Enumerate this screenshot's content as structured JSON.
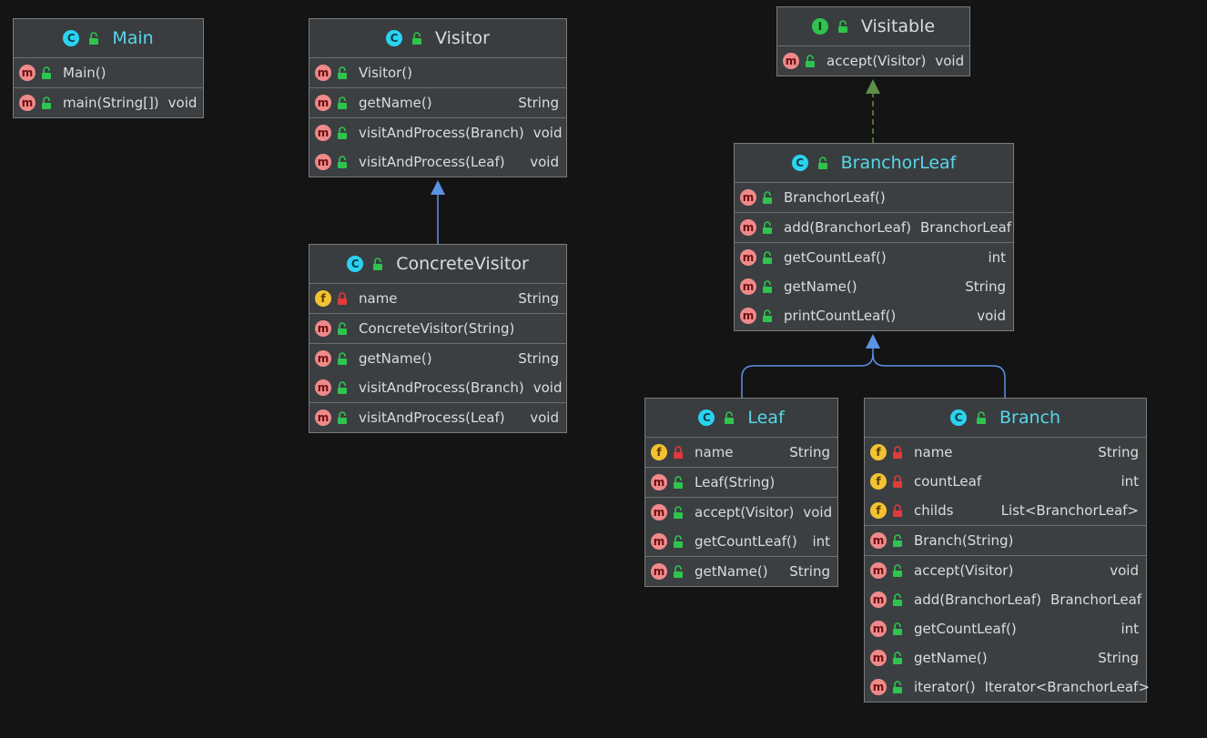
{
  "colors": {
    "background": "#141414",
    "class_box": "#3b3f42",
    "class_name_highlight": "#56d7ea",
    "method_badge": "#f08a8a",
    "field_badge": "#f2c233",
    "class_badge": "#2ad3f0",
    "interface_badge": "#2ec44e",
    "extends_arrow": "#5b93e6",
    "implements_arrow": "#5e8e4a",
    "public_lock": "#2ec44e",
    "private_lock": "#e03a3a"
  },
  "classes": {
    "main": {
      "name": "Main",
      "badge": "C",
      "rows": [
        {
          "badge": "m",
          "name": "Main()",
          "type": ""
        },
        {
          "badge": "m",
          "name": "main(String[])",
          "type": "void"
        }
      ]
    },
    "visitor": {
      "name": "Visitor",
      "badge": "C",
      "rows": [
        {
          "badge": "m",
          "name": "Visitor()",
          "type": ""
        },
        {
          "badge": "m",
          "name": "getName()",
          "type": "String"
        },
        {
          "badge": "m",
          "name": "visitAndProcess(Branch)",
          "type": "void"
        },
        {
          "badge": "m",
          "name": "visitAndProcess(Leaf)",
          "type": "void"
        }
      ]
    },
    "concrete_visitor": {
      "name": "ConcreteVisitor",
      "badge": "C",
      "rows": [
        {
          "badge": "f",
          "name": "name",
          "type": "String"
        },
        {
          "badge": "m",
          "name": "ConcreteVisitor(String)",
          "type": ""
        },
        {
          "badge": "m",
          "name": "getName()",
          "type": "String"
        },
        {
          "badge": "m",
          "name": "visitAndProcess(Branch)",
          "type": "void"
        },
        {
          "badge": "m",
          "name": "visitAndProcess(Leaf)",
          "type": "void"
        }
      ]
    },
    "visitable": {
      "name": "Visitable",
      "badge": "I",
      "rows": [
        {
          "badge": "m",
          "name": "accept(Visitor)",
          "type": "void"
        }
      ]
    },
    "branchor_leaf": {
      "name": "BranchorLeaf",
      "badge": "C",
      "rows": [
        {
          "badge": "m",
          "name": "BranchorLeaf()",
          "type": ""
        },
        {
          "badge": "m",
          "name": "add(BranchorLeaf)",
          "type": "BranchorLeaf"
        },
        {
          "badge": "m",
          "name": "getCountLeaf()",
          "type": "int"
        },
        {
          "badge": "m",
          "name": "getName()",
          "type": "String"
        },
        {
          "badge": "m",
          "name": "printCountLeaf()",
          "type": "void"
        }
      ]
    },
    "leaf": {
      "name": "Leaf",
      "badge": "C",
      "rows": [
        {
          "badge": "f",
          "name": "name",
          "type": "String"
        },
        {
          "badge": "m",
          "name": "Leaf(String)",
          "type": ""
        },
        {
          "badge": "m",
          "name": "accept(Visitor)",
          "type": "void"
        },
        {
          "badge": "m",
          "name": "getCountLeaf()",
          "type": "int"
        },
        {
          "badge": "m",
          "name": "getName()",
          "type": "String"
        }
      ]
    },
    "branch": {
      "name": "Branch",
      "badge": "C",
      "rows": [
        {
          "badge": "f",
          "name": "name",
          "type": "String"
        },
        {
          "badge": "f",
          "name": "countLeaf",
          "type": "int"
        },
        {
          "badge": "f",
          "name": "childs",
          "type": "List<BranchorLeaf>"
        },
        {
          "badge": "m",
          "name": "Branch(String)",
          "type": ""
        },
        {
          "badge": "m",
          "name": "accept(Visitor)",
          "type": "void"
        },
        {
          "badge": "m",
          "name": "add(BranchorLeaf)",
          "type": "BranchorLeaf"
        },
        {
          "badge": "m",
          "name": "getCountLeaf()",
          "type": "int"
        },
        {
          "badge": "m",
          "name": "getName()",
          "type": "String"
        },
        {
          "badge": "m",
          "name": "iterator()",
          "type": "Iterator<BranchorLeaf>"
        }
      ]
    }
  }
}
